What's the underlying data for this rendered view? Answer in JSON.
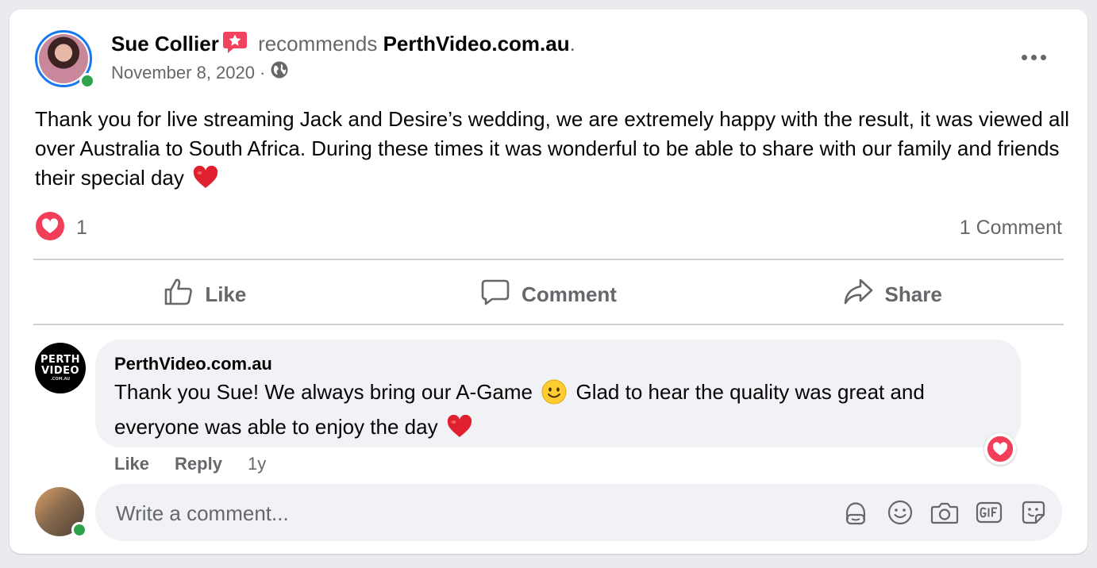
{
  "post": {
    "author": "Sue Collier",
    "action": "recommends",
    "page": "PerthVideo.com.au",
    "page_suffix": ".",
    "date": "November 8, 2020",
    "date_sep": "·",
    "audience_icon": "globe-icon",
    "text": "Thank you for live streaming Jack and Desire’s wedding, we are extremely happy with the result, it was viewed all over Australia to South Africa. During these times it was wonderful to be able to share with our family and friends their special day",
    "reaction_count": "1",
    "comment_count": "1 Comment"
  },
  "actions": {
    "like": "Like",
    "comment": "Comment",
    "share": "Share"
  },
  "comment": {
    "author": "PerthVideo.com.au",
    "avatar_line1": "PERTH",
    "avatar_line2": "VIDEO",
    "avatar_line3": ".COM.AU",
    "text_part1": "Thank you Sue! We always bring our A-Game",
    "text_part2": "Glad to hear the quality was great and everyone was able to enjoy the day",
    "like": "Like",
    "reply": "Reply",
    "time": "1y"
  },
  "composer": {
    "placeholder": "Write a comment...",
    "icons": [
      "avatar-sticker-icon",
      "emoji-icon",
      "camera-icon",
      "gif-icon",
      "sticker-icon"
    ]
  },
  "colors": {
    "accent": "#1877f2",
    "online": "#31a24c",
    "heart": "#f33e58",
    "recommend_badge": "#f3425f",
    "secondary_text": "#65676b"
  }
}
